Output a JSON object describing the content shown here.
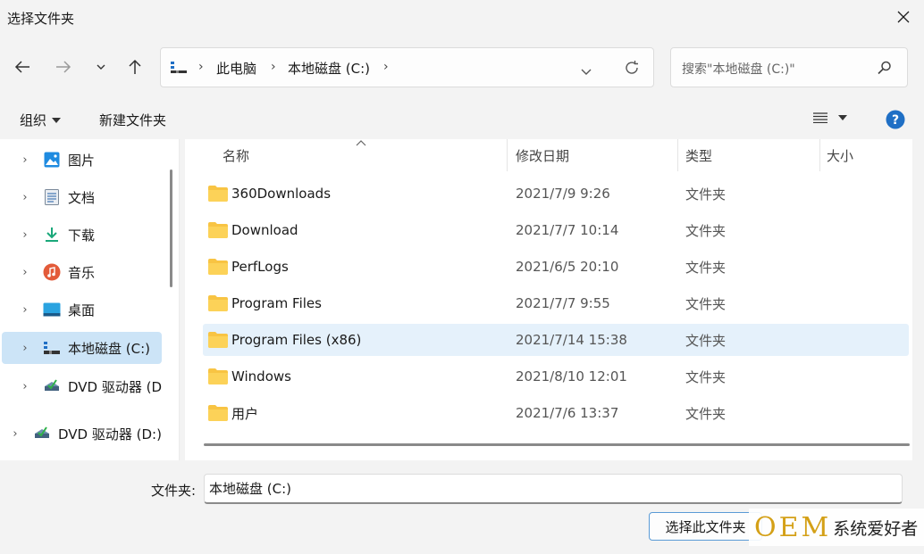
{
  "window": {
    "title": "选择文件夹"
  },
  "nav": {
    "breadcrumbs": [
      "此电脑",
      "本地磁盘 (C:)"
    ],
    "search_placeholder": "搜索\"本地磁盘 (C:)\""
  },
  "toolbar": {
    "organize": "组织",
    "new_folder": "新建文件夹"
  },
  "sidebar": {
    "items": [
      {
        "label": "图片",
        "icon": "pictures-icon"
      },
      {
        "label": "文档",
        "icon": "documents-icon"
      },
      {
        "label": "下载",
        "icon": "downloads-icon"
      },
      {
        "label": "音乐",
        "icon": "music-icon"
      },
      {
        "label": "桌面",
        "icon": "desktop-icon"
      },
      {
        "label": "本地磁盘 (C:)",
        "icon": "drive-icon",
        "selected": true
      },
      {
        "label": "DVD 驱动器 (D",
        "icon": "dvd-icon"
      },
      {
        "label": "DVD 驱动器 (D:)",
        "icon": "dvd-icon"
      }
    ]
  },
  "columns": {
    "name": "名称",
    "date": "修改日期",
    "type": "类型",
    "size": "大小"
  },
  "files": [
    {
      "name": "360Downloads",
      "date": "2021/7/9 9:26",
      "type": "文件夹"
    },
    {
      "name": "Download",
      "date": "2021/7/7 10:14",
      "type": "文件夹"
    },
    {
      "name": "PerfLogs",
      "date": "2021/6/5 20:10",
      "type": "文件夹"
    },
    {
      "name": "Program Files",
      "date": "2021/7/7 9:55",
      "type": "文件夹"
    },
    {
      "name": "Program Files (x86)",
      "date": "2021/7/14 15:38",
      "type": "文件夹"
    },
    {
      "name": "Windows",
      "date": "2021/8/10 12:01",
      "type": "文件夹"
    },
    {
      "name": "用户",
      "date": "2021/7/6 13:37",
      "type": "文件夹"
    }
  ],
  "footer": {
    "folder_label": "文件夹:",
    "folder_value": "本地磁盘 (C:)",
    "select_button": "选择此文件夹"
  },
  "watermark": {
    "brand": "OEM",
    "text": "系统爱好者"
  },
  "colors": {
    "accent": "#0067c0",
    "folder": "#f8c443",
    "selected": "#cce4f7",
    "hover": "#e5f1fb"
  }
}
